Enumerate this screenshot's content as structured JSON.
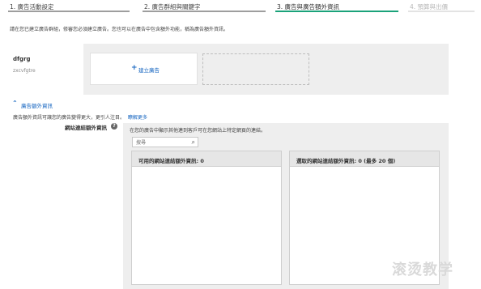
{
  "wizard": {
    "steps": [
      {
        "label": "1. 廣告活動設定",
        "state": "done"
      },
      {
        "label": "2. 廣告群組與關鍵字",
        "state": "done"
      },
      {
        "label": "3. 廣告與廣告額外資訊",
        "state": "active"
      },
      {
        "label": "4. 預算與出價",
        "state": "future"
      }
    ]
  },
  "intro_text": "請在您已建立廣告群組，修審您必須建立廣告。您也可以在廣告中包含額外功能，稱為廣告額外資訊。",
  "ad_group": {
    "name": "dfgrg",
    "subtitle": "zxcvfgtre",
    "new_ad_label": "建立廣告"
  },
  "extensions": {
    "toggle_label": "廣告額外資訊",
    "description": "廣告額外資訊可讓您的廣告變得更大，更引人注目。",
    "learn_more": "瞭解更多",
    "sitelink": {
      "label": "網站連結額外資訊",
      "panel_description": "在您的廣告中顯示其他連到客戶可在您網站上特定網頁的連結。",
      "search_placeholder": "搜尋",
      "available_header": "可用的網站連結額外資訊: 0",
      "selected_header": "選取的網站連結額外資訊: 0 (最多 20 個)"
    }
  },
  "watermark": "滚烫教学",
  "colors": {
    "accent": "#1aa27a",
    "link": "#1565c0",
    "panel": "#eeeeee"
  }
}
